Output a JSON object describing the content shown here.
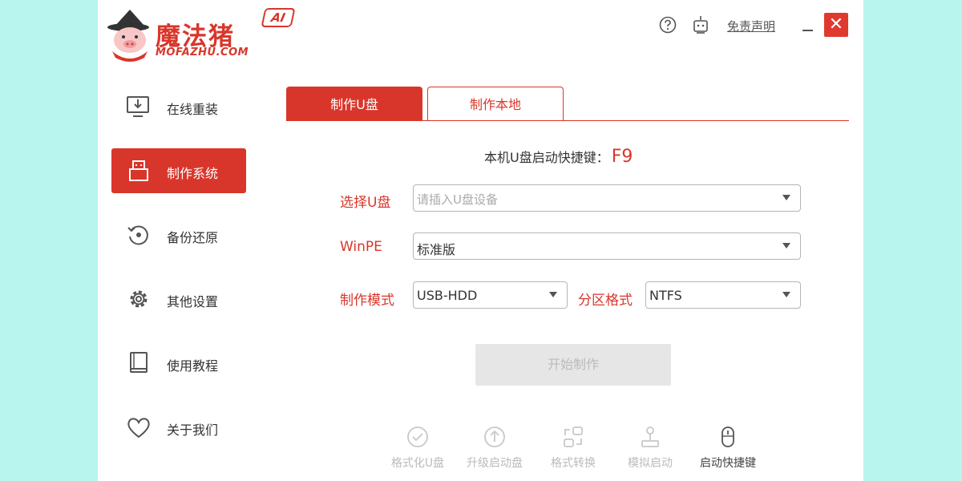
{
  "app": {
    "logo_title": "魔法猪",
    "logo_subtitle": "MOFAZHU.COM",
    "logo_badge": "AI",
    "disclaimer_link": "免责声明",
    "close_symbol": "✕"
  },
  "sidebar": {
    "items": [
      {
        "label": "在线重装",
        "icon": "monitor-download-icon",
        "active": false
      },
      {
        "label": "制作系统",
        "icon": "usb-drive-icon",
        "active": true
      },
      {
        "label": "备份还原",
        "icon": "restore-icon",
        "active": false
      },
      {
        "label": "其他设置",
        "icon": "gear-icon",
        "active": false
      },
      {
        "label": "使用教程",
        "icon": "book-icon",
        "active": false
      },
      {
        "label": "关于我们",
        "icon": "heart-icon",
        "active": false
      }
    ]
  },
  "tabs": [
    {
      "label": "制作U盘",
      "active": true
    },
    {
      "label": "制作本地",
      "active": false
    }
  ],
  "hotkey": {
    "label": "本机U盘启动快捷键：",
    "key": "F9"
  },
  "form": {
    "usb_label": "选择U盘",
    "usb_placeholder": "请插入U盘设备",
    "winpe_label": "WinPE",
    "winpe_value": "标准版",
    "mode_label": "制作模式",
    "mode_value": "USB-HDD",
    "partition_label": "分区格式",
    "partition_value": "NTFS"
  },
  "start_button": "开始制作",
  "bottom_tools": [
    {
      "label": "格式化U盘",
      "icon": "check-circle-icon",
      "enabled": false
    },
    {
      "label": "升级启动盘",
      "icon": "arrow-up-circle-icon",
      "enabled": false
    },
    {
      "label": "格式转换",
      "icon": "convert-icon",
      "enabled": false
    },
    {
      "label": "模拟启动",
      "icon": "joystick-icon",
      "enabled": false
    },
    {
      "label": "启动快捷键",
      "icon": "mouse-icon",
      "enabled": true
    }
  ],
  "colors": {
    "accent": "#d9362b",
    "background": "#b8f5ee",
    "disabled": "#e6e6e6"
  }
}
